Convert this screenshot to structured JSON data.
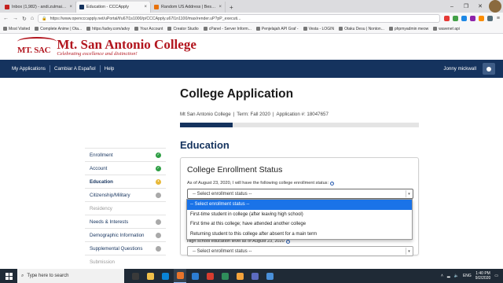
{
  "browser": {
    "tabs": [
      {
        "title": "Inbox (1,982) - andi.zulmai@g...",
        "color": "#c5221f",
        "active": false
      },
      {
        "title": "Education - CCCApply",
        "color": "#15335e",
        "active": true
      },
      {
        "title": "Random US Address | Best Ra...",
        "color": "#e8710a",
        "active": false
      }
    ],
    "new_tab": "+",
    "window_controls": [
      "–",
      "❐",
      "✕"
    ],
    "url": "https://www.opencccapply.net/uPortal/f/u67l1s1000/p/CCCApply.u67l1n1100/max/render.uP?pP_executi...",
    "bookmarks": [
      "Most Visited",
      "Complete Anime | Ota...",
      "https://advy.com/advy",
      "Your Account",
      "Creator Studio",
      "cPanel - Server Inform...",
      "Penjelajah API Graf -",
      "Vesta - LOGIN",
      "Otaku Desu | Nonton...",
      "phpmyadmin meow",
      "wavenet api"
    ]
  },
  "site": {
    "logo_mark": "MT. SAC",
    "logo_name": "Mt. San Antonio College",
    "logo_tagline": "Celebrating excellence and distinction!",
    "nav": [
      "My Applications",
      "Cambiar A Español",
      "Help"
    ],
    "user_name": "Jonny mickwall"
  },
  "page": {
    "title": "College Application",
    "college": "Mt San Antonio College",
    "term": "Term: Fall 2020",
    "application": "Application #: 18047657",
    "progress_fraction": 0.22,
    "section_title": "Education"
  },
  "sidebar": [
    {
      "label": "Enrollment",
      "status": "complete"
    },
    {
      "label": "Account",
      "status": "complete"
    },
    {
      "label": "Education",
      "status": "current"
    },
    {
      "label": "Citizenship/Military",
      "status": "pending"
    },
    {
      "label": "Residency",
      "status": "disabled"
    },
    {
      "label": "Needs & Interests",
      "status": "pending"
    },
    {
      "label": "Demographic Information",
      "status": "pending"
    },
    {
      "label": "Supplemental Questions",
      "status": "pending"
    },
    {
      "label": "Submission",
      "status": "disabled"
    }
  ],
  "status_colors": {
    "complete": "#2e9e44",
    "current": "#e8b93a",
    "pending": "#a9a9a9"
  },
  "enrollment": {
    "card_title": "College Enrollment Status",
    "question": "As of August 23, 2020, I will have the following college enrollment status:",
    "select_value": "-- Select enrollment status --",
    "options": [
      "-- Select enrollment status --",
      "First-time student in college (after leaving high school)",
      "First time at this college; have attended another college",
      "Returning student to this college after absent for a main term"
    ],
    "highlighted_index": 0,
    "question2": "High school education level as of August 23, 2020",
    "select2_value": "-- Select enrollment status --"
  },
  "taskbar": {
    "search_placeholder": "Type here to search",
    "apps": [
      "#3a3a3a",
      "#f0c04a",
      "#0a84d6",
      "#e7742b",
      "#2d7dd2",
      "#d63c2f",
      "#2f8d5b",
      "#f3a33c",
      "#5c6bc0",
      "#4a90d9"
    ],
    "language": "ENG",
    "time": "1:40 PM",
    "date": "9/2/2020"
  }
}
